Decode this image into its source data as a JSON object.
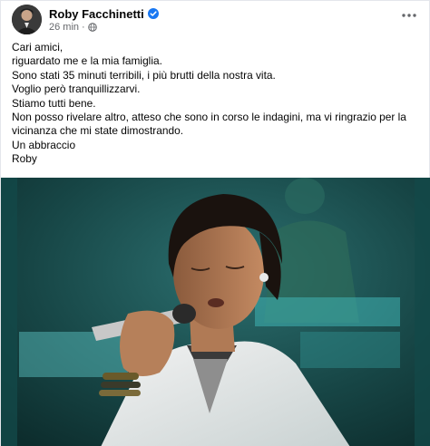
{
  "post": {
    "author": "Roby Facchinetti",
    "time": "26 min",
    "separator": "·",
    "lines": [
      "Cari amici,",
      "riguardato me e la mia famiglia.",
      "Sono stati 35 minuti terribili, i più brutti della nostra vita.",
      "Voglio però tranquillizzarvi.",
      "Stiamo tutti bene.",
      "Non posso rivelare altro, atteso che sono in corso le indagini, ma vi ringrazio per la",
      "vicinanza che mi state dimostrando.",
      "Un abbraccio",
      "Roby"
    ],
    "media_icon": "photo-of-singer-with-microphone"
  },
  "colors": {
    "verified": "#1877f2",
    "meta": "#65676b",
    "stage_background": "#1d5252"
  },
  "icons": {
    "verified": "verified-badge-icon",
    "privacy": "globe-icon",
    "menu": "more-options-icon"
  }
}
